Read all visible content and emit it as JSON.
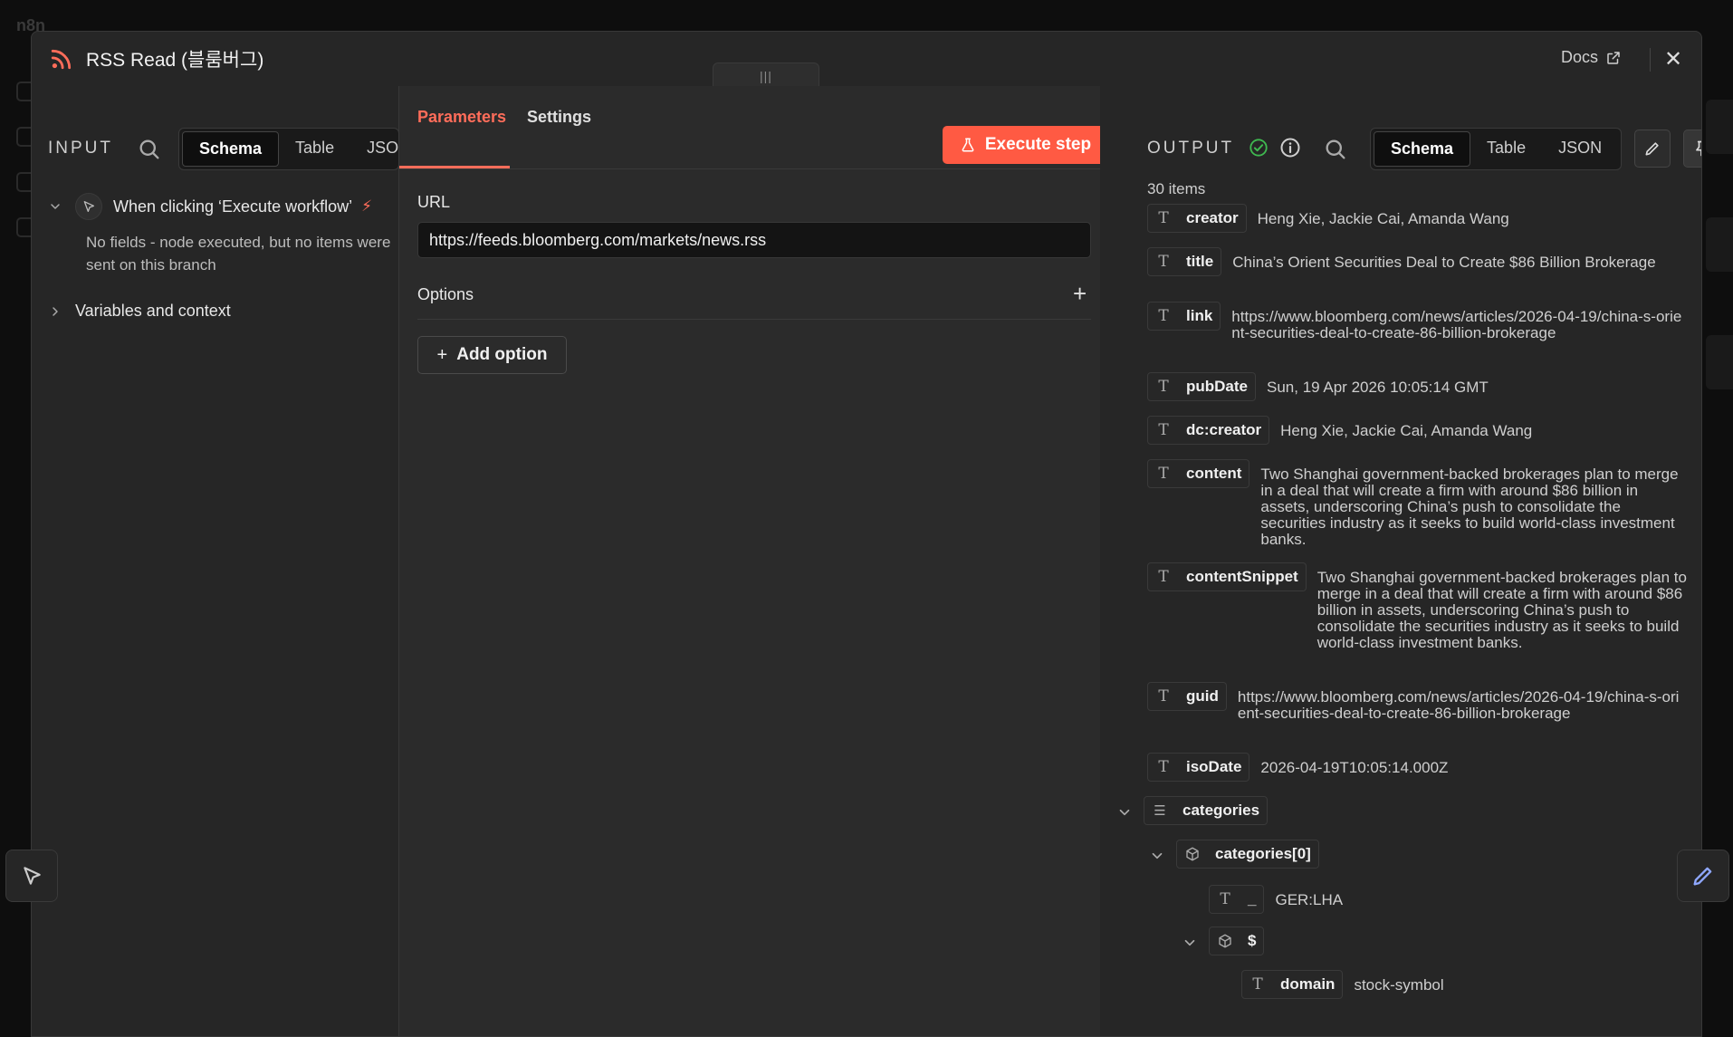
{
  "background": {
    "logo_text": "n8n"
  },
  "modal": {
    "title": "RSS Read (블룸버그)",
    "docs_label": "Docs",
    "close_glyph": "✕",
    "drag_handle_glyph": "|||"
  },
  "input_panel": {
    "label": "INPUT",
    "view_tabs": [
      "Schema",
      "Table",
      "JSON"
    ],
    "active_view": "Schema",
    "trigger_node": "When clicking ‘Execute workflow’",
    "no_fields_message": "No fields - node executed, but no items were sent on this branch",
    "variables_label": "Variables and context"
  },
  "params_panel": {
    "tabs": [
      "Parameters",
      "Settings"
    ],
    "active_tab": "Parameters",
    "execute_label": "Execute step",
    "url_label": "URL",
    "url_value": "https://feeds.bloomberg.com/markets/news.rss",
    "options_label": "Options",
    "add_option_label": "Add option"
  },
  "output_panel": {
    "label": "OUTPUT",
    "view_tabs": [
      "Schema",
      "Table",
      "JSON"
    ],
    "active_view": "Schema",
    "items_count": "30 items",
    "fields": {
      "creator": {
        "key": "creator",
        "value": "Heng Xie, Jackie Cai, Amanda Wang"
      },
      "title": {
        "key": "title",
        "value": "China’s Orient Securities Deal to Create $86 Billion Brokerage"
      },
      "link": {
        "key": "link",
        "value": "https://www.bloomberg.com/news/articles/2026-04-19/china-s-orient-securities-deal-to-create-86-billion-brokerage"
      },
      "pubDate": {
        "key": "pubDate",
        "value": "Sun, 19 Apr 2026 10:05:14 GMT"
      },
      "dc_creator": {
        "key": "dc:creator",
        "value": "Heng Xie, Jackie Cai, Amanda Wang"
      },
      "content": {
        "key": "content",
        "value": "Two Shanghai government-backed brokerages plan to merge in a deal that will create a firm with around $86 billion in assets, underscoring China’s push to consolidate the securities industry as it seeks to build world-class investment banks."
      },
      "contentSnippet": {
        "key": "contentSnippet",
        "value": "Two Shanghai government-backed brokerages plan to merge in a deal that will create a firm with around $86 billion in assets, underscoring China’s push to consolidate the securities industry as it seeks to build world-class investment banks."
      },
      "guid": {
        "key": "guid",
        "value": "https://www.bloomberg.com/news/articles/2026-04-19/china-s-orient-securities-deal-to-create-86-billion-brokerage"
      },
      "isoDate": {
        "key": "isoDate",
        "value": "2026-04-19T10:05:14.000Z"
      },
      "categories": {
        "key": "categories"
      },
      "categories0": {
        "key": "categories[0]"
      },
      "underscore": {
        "key": "_",
        "value": "GER:LHA"
      },
      "dollar": {
        "key": "$"
      },
      "domain": {
        "key": "domain",
        "value": "stock-symbol"
      }
    }
  },
  "colors": {
    "accent": "#ff6d5a",
    "success": "#3fb950"
  },
  "icons": {
    "rss": "rss-icon",
    "search": "search-icon",
    "external": "external-link-icon",
    "close": "close-icon",
    "flask": "flask-icon",
    "plus": "plus-icon",
    "pencil": "pencil-icon",
    "pin": "pin-icon",
    "check": "check-circle-icon",
    "info": "info-icon",
    "pointer": "pointer-icon",
    "bolt": "bolt-icon"
  }
}
